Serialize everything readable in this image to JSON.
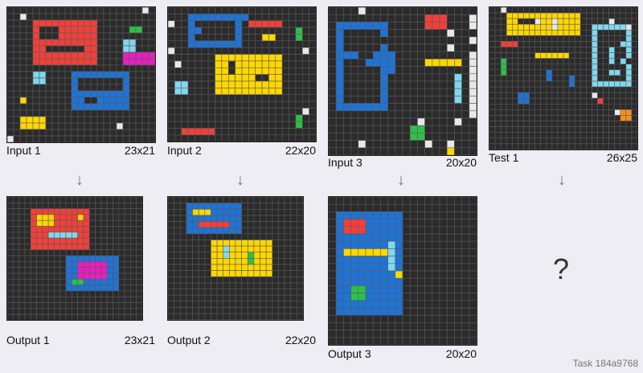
{
  "task_label": "Task 184a9768",
  "question_mark": "?",
  "arrow_glyph": "↓",
  "colors": {
    "0": "#2b2b2b",
    "1": "#1e73d7",
    "2": "#f23f3a",
    "3": "#2ec04a",
    "4": "#ffd700",
    "5": "#aaaaaa",
    "6": "#e91ebf",
    "7": "#ff8c1a",
    "8": "#7fd8f0",
    "9": "#8b1c1c",
    "W": "#e8e8e8",
    "grid": "#5a5a5a"
  },
  "panels": [
    {
      "label": "Input 1",
      "size": "23x21",
      "grid": [
        "000000000000000000000W0",
        "00W00000000000000000000",
        "00002222222222000000000",
        "00002000222222000003300",
        "00002000222222000000000",
        "00002222222222000088000",
        "00002200000022000088000",
        "00002222222222000066666",
        "00002222222222000066666",
        "00000000000000000000000",
        "00008800001111111110000",
        "00008800001000000010000",
        "00000000001000000010000",
        "00000000001111111110000",
        "00400000001100111110000",
        "00000000001111111110000",
        "00000000000000000000000",
        "00444400000000000000000",
        "00444400000000000W00000",
        "00000000000000000000000",
        "W0000000000000000000000"
      ]
    },
    {
      "label": "Input 2",
      "size": "22x20",
      "grid": [
        "0000000000000000000000",
        "0001111111110000000000",
        "W001000000102222200000",
        "0001100000100000000300",
        "0001000000100044000300",
        "0001111111100000000000",
        "W0000000000000000000W0",
        "0000000444444444400000",
        "0W00000440444444400000",
        "0000000440444444400000",
        "0000000444444004400000",
        "0880000444444444400000",
        "0880000444444444400000",
        "0000000000000000000000",
        "0000000000000000000000",
        "00000000000000000000W0",
        "0000000000000000000300",
        "0000000000000000000300",
        "0022222000000000000000",
        "0000000000000000000000"
      ]
    },
    {
      "label": "Input 3",
      "size": "20x20",
      "grid": [
        "0000W000000000000000",
        "0000000000000222000W",
        "0111111100000222000W",
        "0100000100000000W000",
        "0100000000000000000W",
        "0100000100000000W000",
        "0111001110000000000W",
        "0100011110000444440W",
        "0100000110000000000W",
        "0100000100000000080W",
        "0100000100000000080W",
        "0100000100000000080W",
        "0100000100000000080W",
        "0111111100000000000W",
        "0000000000000000000W",
        "000000000000W0000W00",
        "00000000000330000000",
        "00000000000330000000",
        "0000W00000000W00W000",
        "00000000000000004000"
      ]
    },
    {
      "label": "Test 1",
      "size": "26x25",
      "grid": [
        "00W00000000000000000000000",
        "00044444444444440000000000",
        "00044000W44W444400000W0000",
        "00044444444W444400888888W0",
        "00044444444444440080000080",
        "00000000000000000080000080",
        "00222000000000000080000880",
        "00000000000000000080080080",
        "00000000444444000080080080",
        "00300000000000000080080800",
        "00300000000000000080000080",
        "00300000001000000080088080",
        "00000000001000100080000080",
        "00000000000000100088888880",
        "00000000000000000000000000",
        "000001100000000000W0000000",
        "00000110000000000002000000",
        "00000000000000000000000000",
        "0000000000000000000000W770",
        "00000000000000000000000770",
        "00000000000000000000000000",
        "00000000000000000000000000",
        "00000000000000000000000000",
        "00000000000000000000000000",
        "00000000000000000000000000"
      ]
    },
    {
      "label": "Output 1",
      "size": "23x21",
      "grid": [
        "00000000000000000000000",
        "00000000000000000000000",
        "00002222222222000000000",
        "00002444222242000000000",
        "00002444222222000000000",
        "00002222222222000000000",
        "00002228888822000000000",
        "00002222222222000000000",
        "00002222222222000000000",
        "00000000000000000000000",
        "00000000001111111110000",
        "00000000001166666110000",
        "00000000001166666110000",
        "00000000001166666110000",
        "00000000001331111110000",
        "00000000001111111110000",
        "00000000000000000000000",
        "00000000000000000000000",
        "00000000000000000000000",
        "00000000000000000000000",
        "00000000000000000000000"
      ]
    },
    {
      "label": "Output 2",
      "size": "22x20",
      "grid": [
        "0000000000000000000000",
        "0001111111110000000000",
        "0001444111110000000000",
        "0001111111110000000000",
        "0001122222110000000000",
        "0001111111110000000000",
        "0000000000000000000000",
        "0000000444444444400000",
        "0000000448444444400000",
        "0000000448444344400000",
        "0000000444444344400000",
        "0000000444444444400000",
        "0000000444444444400000",
        "0000000000000000000000",
        "0000000000000000000000",
        "0000000000000000000000",
        "0000000000000000000000",
        "0000000000000000000000",
        "0000000000000000000000",
        "0000000000000000000000"
      ]
    },
    {
      "label": "Output 3",
      "size": "20x20",
      "grid": [
        "00000000000000000000",
        "00000000000000000000",
        "01111111110000000000",
        "01222111110000000000",
        "01222111110000000000",
        "01111111110000000000",
        "01111111810000000000",
        "01444444810000000000",
        "01111111810000000000",
        "01111111810000000000",
        "01111111140000000000",
        "01111111110000000000",
        "01133111110000000000",
        "01133111110000000000",
        "01111111110000000000",
        "01111111110000000000",
        "00000000000000000000",
        "00000000000000000000",
        "00000000000000000000",
        "00000000000000000000"
      ]
    }
  ]
}
